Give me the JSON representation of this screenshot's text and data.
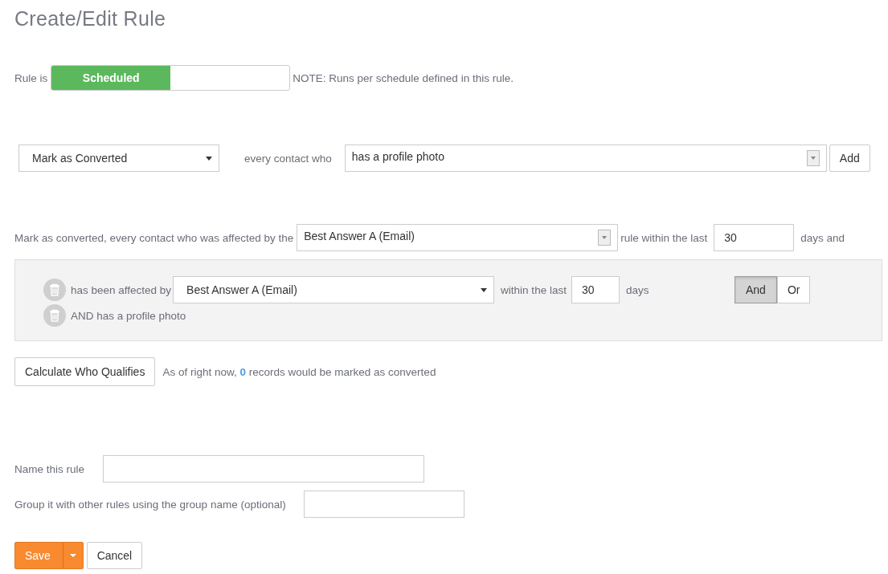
{
  "title": "Create/Edit Rule",
  "status": {
    "label": "Rule is",
    "toggle": {
      "text": "Scheduled",
      "on": true
    },
    "note": "NOTE: Runs per schedule defined in this rule."
  },
  "action": {
    "select": "Mark as Converted",
    "label": "every contact who",
    "condition": "has a profile photo",
    "add_button": "Add"
  },
  "summary": {
    "prefix": "Mark as converted, every contact who was affected by the",
    "rule_select": "Best Answer A (Email)",
    "middle": "rule within the last",
    "days_value": "30",
    "suffix": "days and"
  },
  "conditions": [
    {
      "kind": "affected_by",
      "label": "has been affected by",
      "select": "Best Answer A (Email)",
      "within": "within the last",
      "days_value": "30",
      "days": "days"
    },
    {
      "kind": "text",
      "label": "AND has a profile photo"
    }
  ],
  "logic": [
    {
      "label": "And",
      "selected": true
    },
    {
      "label": "Or",
      "selected": false
    }
  ],
  "calculate": {
    "button": "Calculate Who Qualifies",
    "prefix": "As of right now,",
    "count": "0",
    "suffix": "records would be marked as converted"
  },
  "fields": [
    {
      "label": "Name this rule"
    },
    {
      "label": "Group it with other rules using the group name (optional)"
    }
  ],
  "buttons": {
    "save": "Save",
    "cancel": "Cancel"
  }
}
